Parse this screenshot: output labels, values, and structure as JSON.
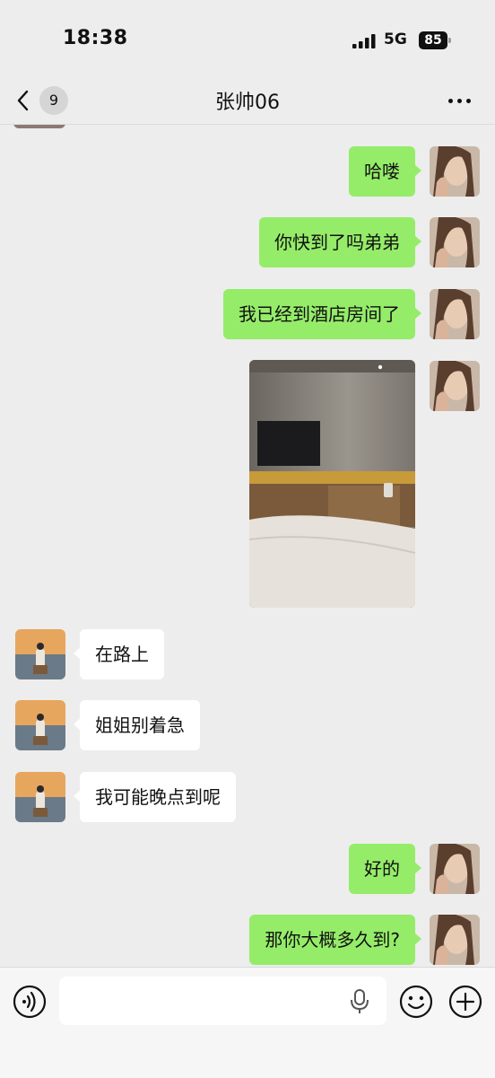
{
  "status_bar": {
    "time": "18:38",
    "network": "5G",
    "battery": "85"
  },
  "nav": {
    "back_count": "9",
    "title": "张帅06"
  },
  "messages": [
    {
      "side": "out",
      "type": "text",
      "text": "哈喽"
    },
    {
      "side": "out",
      "type": "text",
      "text": "你快到了吗弟弟"
    },
    {
      "side": "out",
      "type": "text",
      "text": "我已经到酒店房间了"
    },
    {
      "side": "out",
      "type": "image",
      "image": "hotel-room-photo"
    },
    {
      "side": "in",
      "type": "text",
      "text": "在路上"
    },
    {
      "side": "in",
      "type": "text",
      "text": "姐姐别着急"
    },
    {
      "side": "in",
      "type": "text",
      "text": "我可能晚点到呢"
    },
    {
      "side": "out",
      "type": "text",
      "text": "好的"
    },
    {
      "side": "out",
      "type": "text",
      "text": "那你大概多久到?"
    }
  ],
  "input_bar": {
    "message_value": "",
    "icons": [
      "voice-mode-icon",
      "microphone-icon",
      "emoji-icon",
      "plus-icon"
    ]
  },
  "colors": {
    "background": "#ededed",
    "outgoing_bubble": "#95ec69",
    "incoming_bubble": "#ffffff"
  }
}
